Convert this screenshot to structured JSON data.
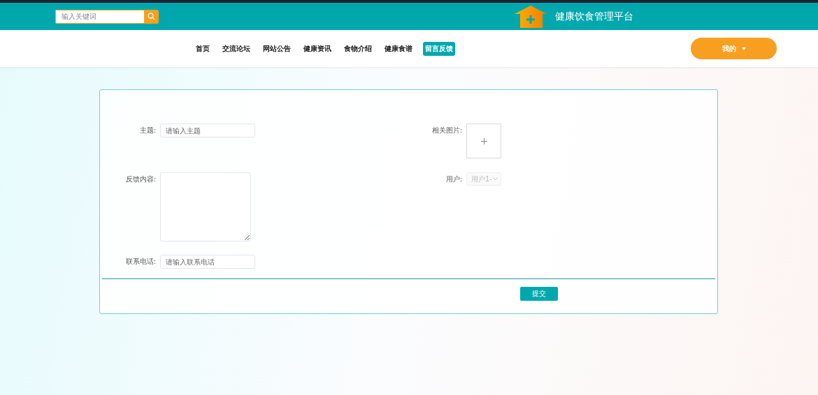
{
  "header": {
    "search": {
      "placeholder": "输入关键词"
    },
    "site_title": "健康饮食管理平台"
  },
  "nav": {
    "items": [
      {
        "label": "首页",
        "selected": false
      },
      {
        "label": "交流论坛",
        "selected": false
      },
      {
        "label": "网站公告",
        "selected": false
      },
      {
        "label": "健康资讯",
        "selected": false
      },
      {
        "label": "食物介绍",
        "selected": false
      },
      {
        "label": "健康食谱",
        "selected": false
      },
      {
        "label": "留言反馈",
        "selected": true
      }
    ],
    "user_menu": "我的"
  },
  "form": {
    "left": [
      {
        "kind": "input",
        "label": "主题:",
        "placeholder": "请输入主题"
      },
      {
        "kind": "textarea",
        "label": "反馈内容:"
      },
      {
        "kind": "input",
        "label": "联系电话:",
        "placeholder": "请输入联系电话"
      }
    ],
    "right": [
      {
        "kind": "upload",
        "label": "相关图片:"
      },
      {
        "kind": "select",
        "label": "用户:",
        "value": "用户1-",
        "disabled": true
      }
    ],
    "submit": "提交"
  }
}
